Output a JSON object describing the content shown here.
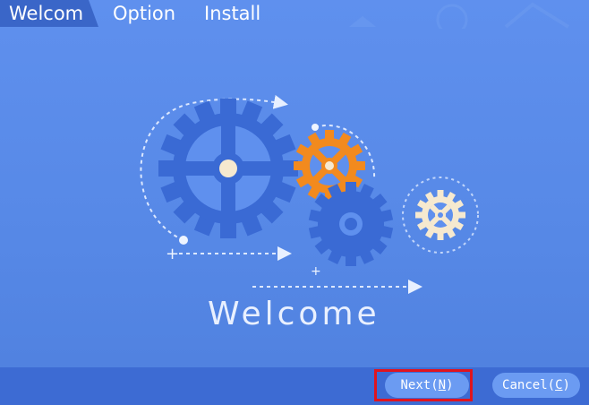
{
  "window": {
    "tabs": [
      {
        "label": "Welcom",
        "active": true
      },
      {
        "label": "Option",
        "active": false
      },
      {
        "label": "Install",
        "active": false
      }
    ]
  },
  "main": {
    "welcome_text": "Welcome"
  },
  "footer": {
    "next": {
      "label": "Next(",
      "key": "N",
      "close": ")"
    },
    "cancel": {
      "label": "Cancel(",
      "key": "C",
      "close": ")"
    }
  },
  "colors": {
    "background": "#5a8be8",
    "gear_primary": "#3a6ad4",
    "gear_accent": "#f28a1e",
    "gear_cream": "#f6e9cf",
    "highlight": "#e0141e"
  }
}
